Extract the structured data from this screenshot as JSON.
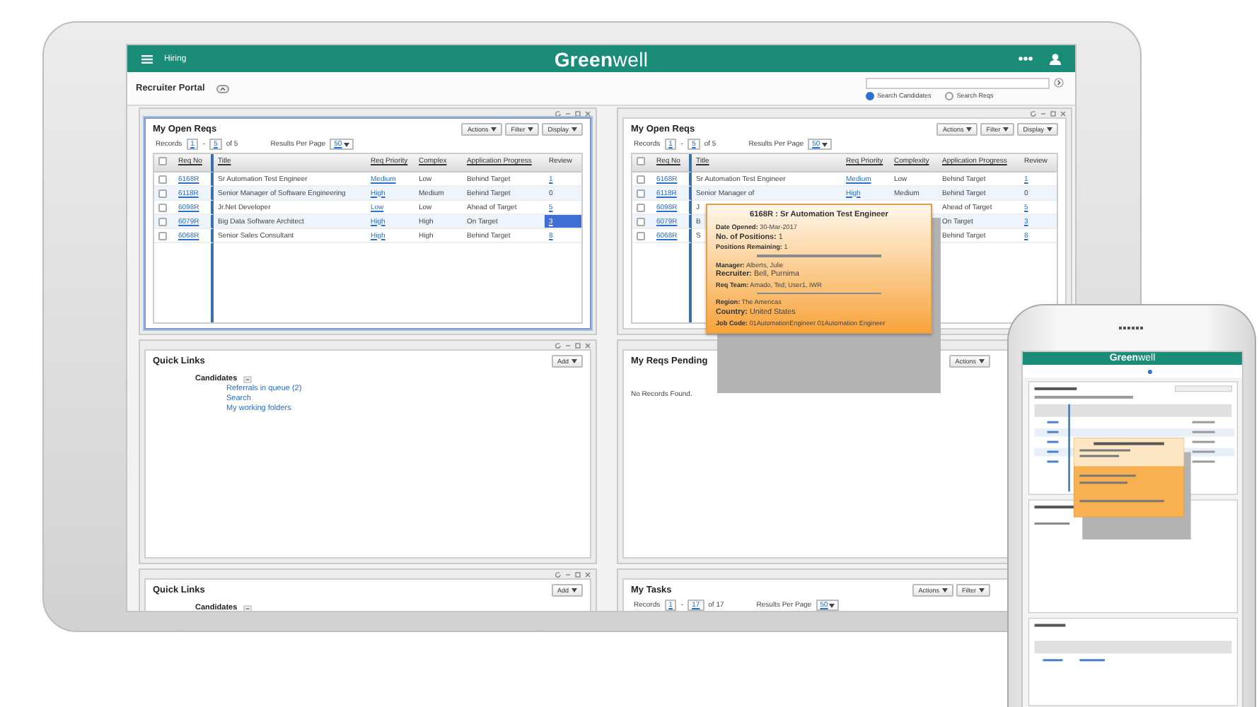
{
  "top_bar": {
    "menu_label": "Hiring",
    "logo": "**Green**well"
  },
  "portal": {
    "title": "Recruiter Portal",
    "search_options": [
      {
        "label": "Search Candidates",
        "selected": true
      },
      {
        "label": "Search Reqs",
        "selected": false
      }
    ]
  },
  "panels": [
    {
      "kind": "reqs",
      "active": true,
      "title": "My Open Reqs",
      "buttons": [
        "Actions",
        "Filter",
        "Display"
      ],
      "records": {
        "label": "Records",
        "from": "1",
        "separator": "-",
        "to": "5",
        "total": "of 5",
        "per_page_label": "Results Per Page",
        "per_page": "50"
      },
      "table": {
        "select_all_checked": false,
        "columns": [
          "Req No",
          "Title",
          "Req Priority",
          "Complex",
          "Application Progress",
          "Review"
        ],
        "rows": [
          {
            "checked": false,
            "req_no": "6168R",
            "title": "Sr Automation Test Engineer",
            "priority": "Medium",
            "complexity": "Low",
            "progress": "Behind Target",
            "review": "1",
            "review_linked": true,
            "review_selected": false
          },
          {
            "checked": false,
            "req_no": "6118R",
            "title": "Senior Manager of Software Engineering",
            "priority": "High",
            "complexity": "Medium",
            "progress": "Behind Target",
            "review": "0",
            "review_linked": false,
            "review_selected": false
          },
          {
            "checked": false,
            "req_no": "6098R",
            "title": "Jr.Net Developer",
            "priority": "Low",
            "complexity": "Low",
            "progress": "Ahead of Target",
            "review": "5",
            "review_linked": true,
            "review_selected": false
          },
          {
            "checked": false,
            "req_no": "6079R",
            "title": "Big Data Software Architect",
            "priority": "High",
            "complexity": "High",
            "progress": "On Target",
            "review": "3",
            "review_linked": true,
            "review_selected": true
          },
          {
            "checked": false,
            "req_no": "6068R",
            "title": "Senior Sales Consultant",
            "priority": "High",
            "complexity": "High",
            "progress": "Behind Target",
            "review": "8",
            "review_linked": true,
            "review_selected": false
          }
        ]
      }
    },
    {
      "kind": "reqs",
      "active": false,
      "title": "My Open Reqs",
      "buttons": [
        "Actions",
        "Filter",
        "Display"
      ],
      "records": {
        "label": "Records",
        "from": "1",
        "separator": "-",
        "to": "5",
        "total": "of 5",
        "per_page_label": "Results Per Page",
        "per_page": "50"
      },
      "table": {
        "select_all_checked": false,
        "columns": [
          "Req No",
          "Title",
          "Req Priority",
          "Complexity",
          "Application Progress",
          "Review"
        ],
        "rows": [
          {
            "checked": false,
            "req_no": "6168R",
            "title": "Sr Automation Test Engineer",
            "priority": "Medium",
            "complexity": "Low",
            "progress": "Behind Target",
            "review": "1",
            "review_linked": true,
            "review_selected": false
          },
          {
            "checked": false,
            "req_no": "6118R",
            "title": "Senior Manager of",
            "priority": "High",
            "complexity": "Medium",
            "progress": "Behind Target",
            "review": "0",
            "review_linked": false,
            "review_selected": false
          },
          {
            "checked": false,
            "req_no": "6098R",
            "title": "J",
            "progress": "Ahead of Target",
            "review": "5",
            "review_linked": true,
            "review_selected": false
          },
          {
            "checked": false,
            "req_no": "6079R",
            "title": "B",
            "progress": "On Target",
            "review": "3",
            "review_linked": true,
            "review_selected": false
          },
          {
            "checked": false,
            "req_no": "6068R",
            "title": "S",
            "progress": "Behind Target",
            "review": "8",
            "review_linked": true,
            "review_selected": false
          }
        ]
      }
    },
    {
      "kind": "links",
      "active": false,
      "title": "Quick Links",
      "buttons": [
        "Add"
      ],
      "group": {
        "title": "Candidates",
        "expanded": true,
        "links": [
          "Referrals in queue (2)",
          "Search",
          "My working folders"
        ]
      }
    },
    {
      "kind": "empty",
      "active": false,
      "title": "My Reqs Pending",
      "buttons": [
        "Actions"
      ],
      "message": "No Records Found."
    },
    {
      "kind": "links",
      "active": false,
      "title": "Quick Links",
      "buttons": [
        "Add"
      ],
      "group": {
        "title": "Candidates",
        "expanded": true
      }
    },
    {
      "kind": "tasks",
      "active": false,
      "title": "My Tasks",
      "buttons": [
        "Actions",
        "Filter"
      ],
      "records": {
        "label": "Records",
        "from": "1",
        "separator": "-",
        "to": "17",
        "total": "of 17",
        "per_page_label": "Results Per Page",
        "per_page": "50"
      }
    }
  ],
  "tooltip": {
    "title": "6168R : Sr Automation Test Engineer",
    "groups": [
      [
        {
          "label": "Date Opened:",
          "value": "30-Mar-2017",
          "emphasis": false
        },
        {
          "label": "No. of Positions:",
          "value": "1",
          "emphasis": true
        },
        {
          "label": "Positions Remaining:",
          "value": "1",
          "emphasis": false
        }
      ],
      [
        {
          "label": "Manager:",
          "value": "Alberts, Julie",
          "emphasis": false
        },
        {
          "label": "Recruiter:",
          "value": "Bell, Purnima",
          "emphasis": true
        },
        {
          "label": "Req Team:",
          "value": "Amado, Ted; User1, IWR",
          "emphasis": false
        }
      ],
      [
        {
          "label": "Region:",
          "value": "The Americas",
          "emphasis": false
        },
        {
          "label": "Country:",
          "value": "United States",
          "emphasis": true
        },
        {
          "label": "Job Code:",
          "value": "01AutomationEngineer 01Automation Engineer",
          "emphasis": false
        }
      ]
    ]
  },
  "phone": {
    "logo": "**Green**well"
  }
}
